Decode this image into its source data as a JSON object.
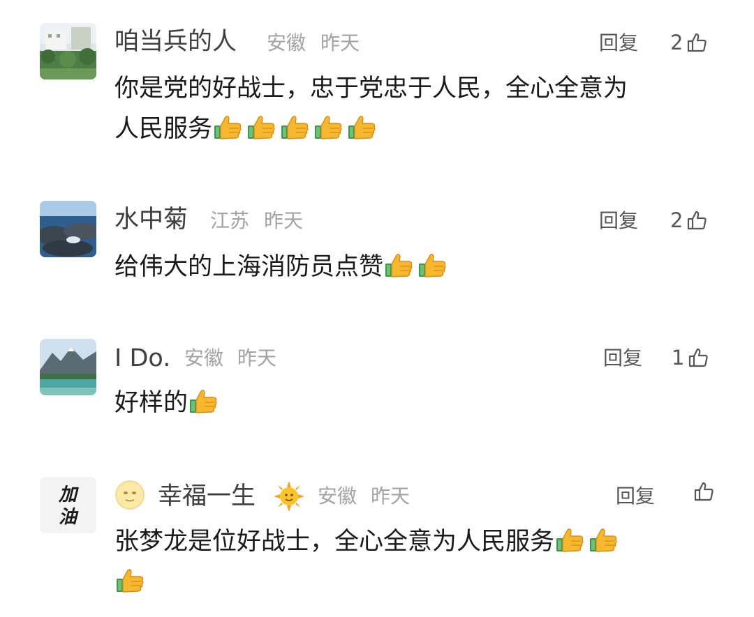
{
  "comments": [
    {
      "username": "咱当兵的人",
      "location": "安徽",
      "time": "昨天",
      "reply_label": "回复",
      "likes": "2",
      "text_line1": "你是党的好战士，忠于党忠于人民，全心全意为",
      "text_line2": "人民服务",
      "thumbs": 5
    },
    {
      "username": "水中菊",
      "location": "江苏",
      "time": "昨天",
      "reply_label": "回复",
      "likes": "2",
      "text_line1": "给伟大的上海消防员点赞",
      "thumbs": 2
    },
    {
      "username": "I Do.",
      "location": "安徽",
      "time": "昨天",
      "reply_label": "回复",
      "likes": "1",
      "text_line1": "好样的",
      "thumbs": 1
    },
    {
      "username": "幸福一生",
      "location": "安徽",
      "time": "昨天",
      "reply_label": "回复",
      "likes": "",
      "avatar_text": "加油",
      "text_line1": "张梦龙是位好战士，全心全意为人民服务",
      "thumbs_line1": 2,
      "thumbs_line2": 1
    }
  ],
  "icons": {
    "like": "thumbs-up-outline-icon",
    "emoji_thumb": "thumbs-up-emoji",
    "moon": "moon-face-emoji",
    "sun": "sun-face-emoji"
  },
  "colors": {
    "username": "#3f3f3f",
    "meta": "#a3a3a3",
    "text": "#1a1a1a",
    "emoji_yellow": "#f5b82e"
  }
}
